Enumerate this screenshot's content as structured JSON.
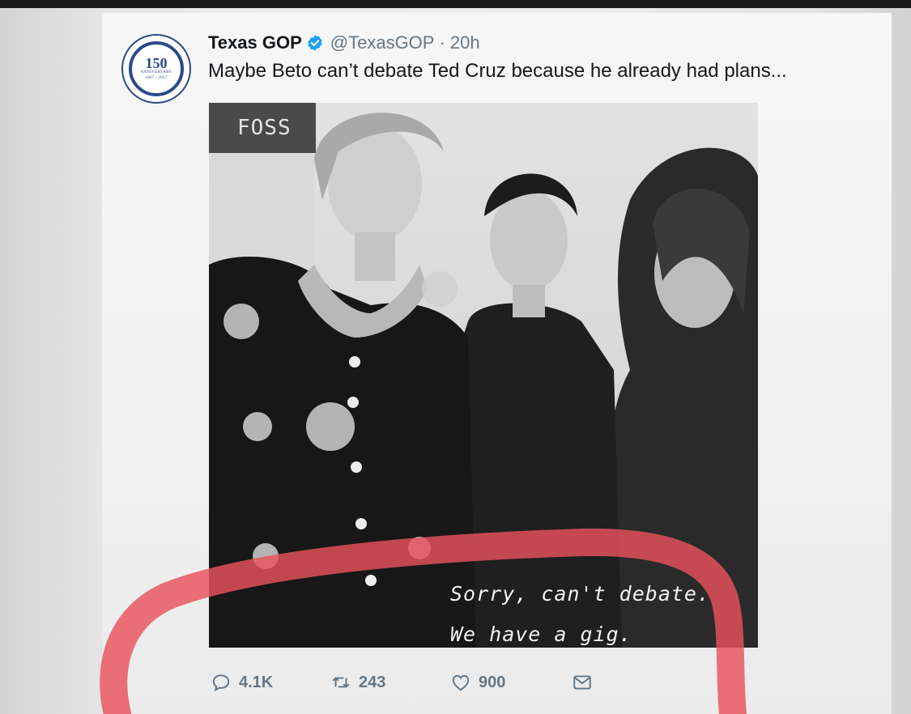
{
  "tweet": {
    "author_name": "Texas GOP",
    "handle": "@TexasGOP",
    "time": "· 20h",
    "text": "Maybe Beto can’t debate Ted Cruz because he already had plans..."
  },
  "avatar": {
    "number": "150",
    "label": "ANNIVERSARY",
    "years": "1867 - 2017"
  },
  "photo": {
    "sign": "FOSS",
    "caption_line1": "Sorry, can't debate.",
    "caption_line2": "We have a gig."
  },
  "actions": {
    "replies": "4.1K",
    "retweets": "243",
    "likes": "900"
  },
  "colors": {
    "verified": "#1da1f2",
    "icon_gray": "#657786",
    "annotation_red": "#e8525d",
    "avatar_blue": "#2c4a85"
  },
  "icons": [
    "verified-badge-icon",
    "reply-icon",
    "retweet-icon",
    "like-icon",
    "direct-message-icon"
  ]
}
